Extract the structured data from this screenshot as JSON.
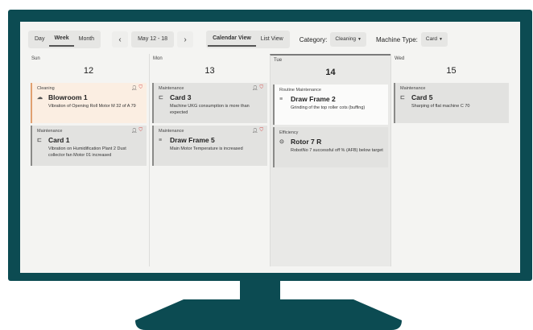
{
  "toolbar": {
    "views": [
      "Day",
      "Week",
      "Month"
    ],
    "active_view": "Week",
    "prev_icon": "chevron-left-icon",
    "next_icon": "chevron-right-icon",
    "date_range": "May 12 - 18",
    "mode_tabs": [
      "Calendar View",
      "List View"
    ],
    "active_mode": "Calendar View",
    "category_label": "Category:",
    "category_value": "Cleaning",
    "machine_type_label": "Machine Type:",
    "machine_type_value": "Card"
  },
  "days": [
    {
      "name": "Sun",
      "number": "12",
      "today": false,
      "cards": [
        {
          "category": "Cleaning",
          "title": "Blowroom 1",
          "description": "Vibration of Opening Roll Motor M 32 of A 79",
          "icon": "cloud-icon",
          "style": "cleaning",
          "actions": true
        },
        {
          "category": "Maintenance",
          "title": "Card 1",
          "description": "Vibration on Humidification Plant 2 Dust collector fan Motor 01 increased",
          "icon": "card-machine-icon",
          "style": "grey",
          "actions": true
        }
      ]
    },
    {
      "name": "Mon",
      "number": "13",
      "today": false,
      "cards": [
        {
          "category": "Maintenance",
          "title": "Card 3",
          "description": "Machine UKG consumption is more than expected",
          "icon": "card-machine-icon",
          "style": "grey",
          "actions": true
        },
        {
          "category": "Maintenance",
          "title": "Draw Frame 5",
          "description": "Main Motor Temperature is increased",
          "icon": "draw-frame-icon",
          "style": "grey",
          "actions": true
        }
      ]
    },
    {
      "name": "Tue",
      "number": "14",
      "today": true,
      "cards": [
        {
          "category": "Routine Maintenance",
          "title": "Draw Frame 2",
          "description": "Grinding of the top roller cots (buffing)",
          "icon": "draw-frame-icon",
          "style": "white",
          "actions": false
        },
        {
          "category": "Efficiency",
          "title": "Rotor 7 R",
          "description": "RobotNo 7 successful off % (AFB) below target",
          "icon": "rotor-icon",
          "style": "grey",
          "actions": false
        }
      ]
    },
    {
      "name": "Wed",
      "number": "15",
      "today": false,
      "cards": [
        {
          "category": "Maintenance",
          "title": "Card 5",
          "description": "Sharping of flat machine C 70",
          "icon": "card-machine-icon",
          "style": "grey",
          "actions": false
        }
      ]
    }
  ],
  "colors": {
    "frame": "#0c4b52",
    "screen_bg": "#f4f4f2",
    "cleaning_bg": "#fbeee2",
    "cleaning_border": "#e0a070",
    "alert": "#d64545"
  }
}
